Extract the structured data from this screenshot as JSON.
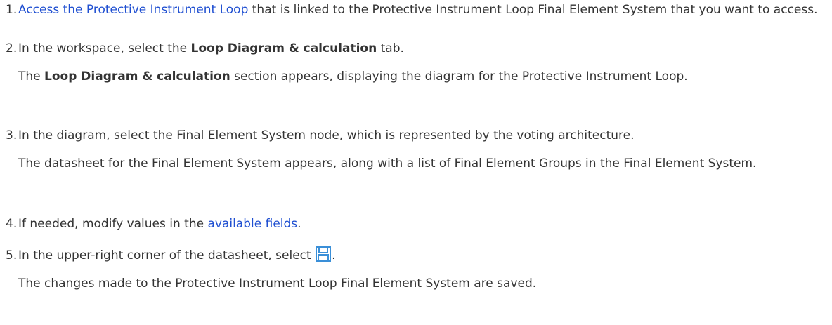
{
  "steps": [
    {
      "number": "1.",
      "link_text": "Access the Protective Instrument Loop",
      "text_after_link": " that is linked to the Protective Instrument Loop Final Element System that you want to access."
    },
    {
      "number": "2.",
      "text_before": "In the workspace, select the ",
      "bold": "Loop Diagram & calculation",
      "text_after": " tab.",
      "result_bold": "Loop Diagram & calculation",
      "result_text": " section appears, displaying the diagram for the Protective Instrument Loop.",
      "result_prefix": "The "
    },
    {
      "number": "3.",
      "text": "In the diagram, select the Final Element System node, which is represented by the voting architecture.",
      "result_text": "The datasheet for the Final Element System appears, along with a list of Final Element Groups in the Final Element System."
    },
    {
      "number": "4.",
      "text_before": "If needed, modify values in the ",
      "link_text": "available fields",
      "text_after": "."
    },
    {
      "number": "5.",
      "text_before": "In the upper-right corner of the datasheet, select ",
      "icon": "save-icon",
      "text_after": ".",
      "result_text": "The changes made to the Protective Instrument Loop Final Element System are saved."
    }
  ],
  "colors": {
    "text": "#333333",
    "link": "#1f4fd1",
    "icon_blue": "#3a8fd8"
  }
}
